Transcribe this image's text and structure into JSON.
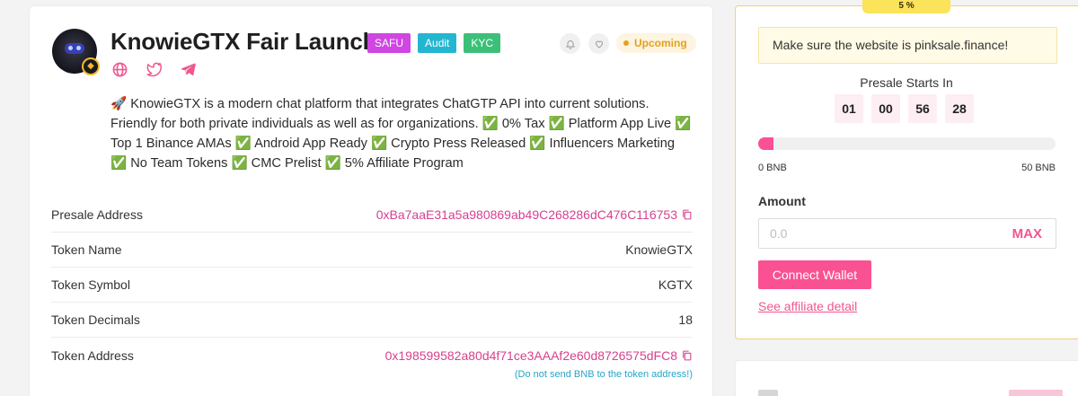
{
  "project": {
    "title": "KnowieGTX Fair Launch",
    "tags": [
      "SAFU",
      "Audit",
      "KYC"
    ],
    "status": "Upcoming",
    "description": "🚀 KnowieGTX is a modern chat platform that integrates ChatGTP API into current solutions. Friendly for both private individuals as well as for organizations. ✅ 0% Tax ✅ Platform App Live ✅ Top 1 Binance AMAs ✅ Android App Ready ✅ Crypto Press Released ✅ Influencers Marketing ✅ No Team Tokens ✅ CMC Prelist ✅ 5% Affiliate Program",
    "socials": [
      "globe-icon",
      "twitter-icon",
      "telegram-icon"
    ]
  },
  "details": {
    "presale_address": {
      "label": "Presale Address",
      "value": "0xBa7aaE31a5a980869ab49C268286dC476C116753"
    },
    "token_name": {
      "label": "Token Name",
      "value": "KnowieGTX"
    },
    "token_symbol": {
      "label": "Token Symbol",
      "value": "KGTX"
    },
    "token_decimals": {
      "label": "Token Decimals",
      "value": "18"
    },
    "token_address": {
      "label": "Token Address",
      "value": "0x198599582a80d4f71ce3AAAf2e60d8726575dFC8",
      "note": "(Do not send BNB to the token address!)"
    }
  },
  "presale": {
    "progress_label": "5 %",
    "progress_fraction": 0.05,
    "notice": "Make sure the website is pinksale.finance!",
    "starts_label": "Presale Starts In",
    "countdown": [
      "01",
      "00",
      "56",
      "28"
    ],
    "range_min": "0 BNB",
    "range_max": "50 BNB",
    "amount_label": "Amount",
    "amount_placeholder": "0.0",
    "max_label": "MAX",
    "connect_label": "Connect Wallet",
    "affiliate_label": "See affiliate detail"
  },
  "colors": {
    "accent": "#f95192",
    "link": "#d6418e",
    "safu": "#d046e2",
    "audit": "#23b6d0",
    "kyc": "#3cc079",
    "upcoming": "#e3a11b"
  }
}
